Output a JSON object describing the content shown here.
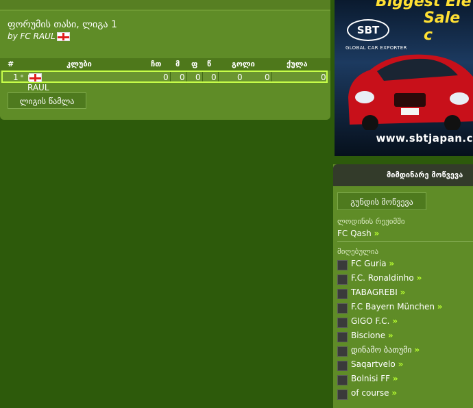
{
  "league": {
    "title": "ფორუმის თასი, ლიგა 1",
    "author": "by FC RAUL",
    "columns": {
      "rank": "#",
      "club": "კლუბი",
      "played": "ჩთ",
      "wins": "მ",
      "draws": "ფ",
      "losses": "წ",
      "goals": "გოლი",
      "points": "ქულა"
    },
    "rows": [
      {
        "rank": "1",
        "club": "FC RAUL",
        "played": "0",
        "wins": "0",
        "draws": "0",
        "losses": "0",
        "goals_for": "0",
        "goals_against": "0",
        "points": "0"
      }
    ],
    "table_button": "ლიგის წამლა"
  },
  "ad": {
    "headline1": "Biggest Ele",
    "headline2": "Sale c",
    "logo": "SBT",
    "tagline": "GLOBAL CAR EXPORTER",
    "url": "www.sbtjapan.c"
  },
  "matches": {
    "header": "მიმდინარე მოწვევა",
    "invite_button": "გუნდის მოწვევა",
    "waiting_label": "ლოდინის რეჟიმში",
    "waiting_team": "FC Qash",
    "accepted_label": "მიღებულია",
    "chevron": "»",
    "teams": [
      "FC Guria",
      "F.C. Ronaldinho",
      "TABAGREBI",
      "F.C Bayern München",
      "GIGO F.C.",
      "Biscione",
      "დინამო ბათუმი",
      "Saqartvelo",
      "Bolnisi FF",
      "of course"
    ]
  },
  "colors": {
    "background": "#2d5a0b",
    "panel": "#5f8c27",
    "highlight": "#c8ff4a",
    "accent_chevron": "#b8ff2f"
  }
}
